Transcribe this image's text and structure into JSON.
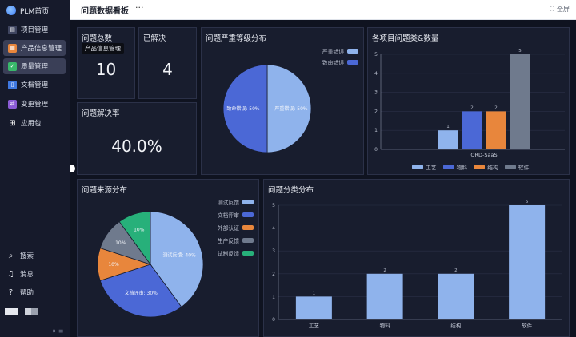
{
  "app": {
    "title": "PLM首页"
  },
  "sidebar": {
    "items": [
      {
        "label": "项目管理",
        "icon": "project-icon",
        "color": "#3f4560",
        "active": false
      },
      {
        "label": "产品信息管理",
        "icon": "product-icon",
        "color": "#e8863c",
        "active": true
      },
      {
        "label": "质量管理",
        "icon": "quality-icon",
        "color": "#39b86b",
        "active": true
      },
      {
        "label": "文档管理",
        "icon": "document-icon",
        "color": "#3f78e0",
        "active": false
      },
      {
        "label": "变更管理",
        "icon": "change-icon",
        "color": "#8b5cd6",
        "active": false
      },
      {
        "label": "应用包",
        "icon": "grid-icon",
        "color": "",
        "active": false
      }
    ],
    "bottom": [
      {
        "label": "搜索",
        "icon": "search-icon"
      },
      {
        "label": "消息",
        "icon": "bell-icon"
      },
      {
        "label": "帮助",
        "icon": "help-icon"
      }
    ],
    "collapse_icon": "collapse-icon"
  },
  "header": {
    "title": "问题数据看板",
    "more": "···",
    "fullscreen": "全屏"
  },
  "cards": {
    "total": {
      "title": "问题总数",
      "value": "10",
      "tooltip": "产品信息管理"
    },
    "resolved": {
      "title": "已解决",
      "value": "4"
    },
    "rate": {
      "title": "问题解决率",
      "value": "40.0%"
    },
    "severity": {
      "title": "问题严重等级分布"
    },
    "by_project": {
      "title": "各项目问题类&数量"
    },
    "source": {
      "title": "问题来源分布"
    },
    "category": {
      "title": "问题分类分布"
    }
  },
  "chart_data": [
    {
      "type": "pie",
      "title": "问题严重等级分布",
      "categories": [
        "严重错误",
        "致命错误"
      ],
      "values": [
        50,
        50
      ],
      "slice_labels": [
        "严重错误: 50%",
        "致命错误: 50%"
      ],
      "colors": [
        "#8fb3ec",
        "#4b68d6"
      ],
      "legend": "top-right"
    },
    {
      "type": "bar",
      "title": "各项目问题类&数量",
      "categories": [
        "QRD-SaaS"
      ],
      "series": [
        {
          "name": "工艺",
          "values": [
            1
          ],
          "color": "#8fb3ec"
        },
        {
          "name": "物料",
          "values": [
            2
          ],
          "color": "#4b68d6"
        },
        {
          "name": "结构",
          "values": [
            2
          ],
          "color": "#e8863c"
        },
        {
          "name": "软件",
          "values": [
            5
          ],
          "color": "#6f7a8d"
        }
      ],
      "ylim": [
        0,
        5
      ],
      "yticks": [
        "0",
        "1",
        "2",
        "3",
        "4",
        "5"
      ],
      "legend": "bottom"
    },
    {
      "type": "pie",
      "title": "问题来源分布",
      "categories": [
        "测试反馈",
        "文档评审",
        "外部认证",
        "生产反馈",
        "试制反馈"
      ],
      "values": [
        40,
        30,
        10,
        10,
        10
      ],
      "slice_labels": [
        "测试反馈: 40%",
        "文档评审: 30%",
        "10%",
        "10%",
        "10%"
      ],
      "colors": [
        "#8fb3ec",
        "#4b68d6",
        "#e8863c",
        "#6f7a8d",
        "#27b07a"
      ],
      "legend": "top-right"
    },
    {
      "type": "bar",
      "title": "问题分类分布",
      "categories": [
        "工艺",
        "物料",
        "结构",
        "软件"
      ],
      "values": [
        1,
        2,
        2,
        5
      ],
      "color": "#8fb3ec",
      "ylim": [
        0,
        5
      ],
      "yticks": [
        "0",
        "1",
        "2",
        "3",
        "4",
        "5"
      ]
    }
  ]
}
